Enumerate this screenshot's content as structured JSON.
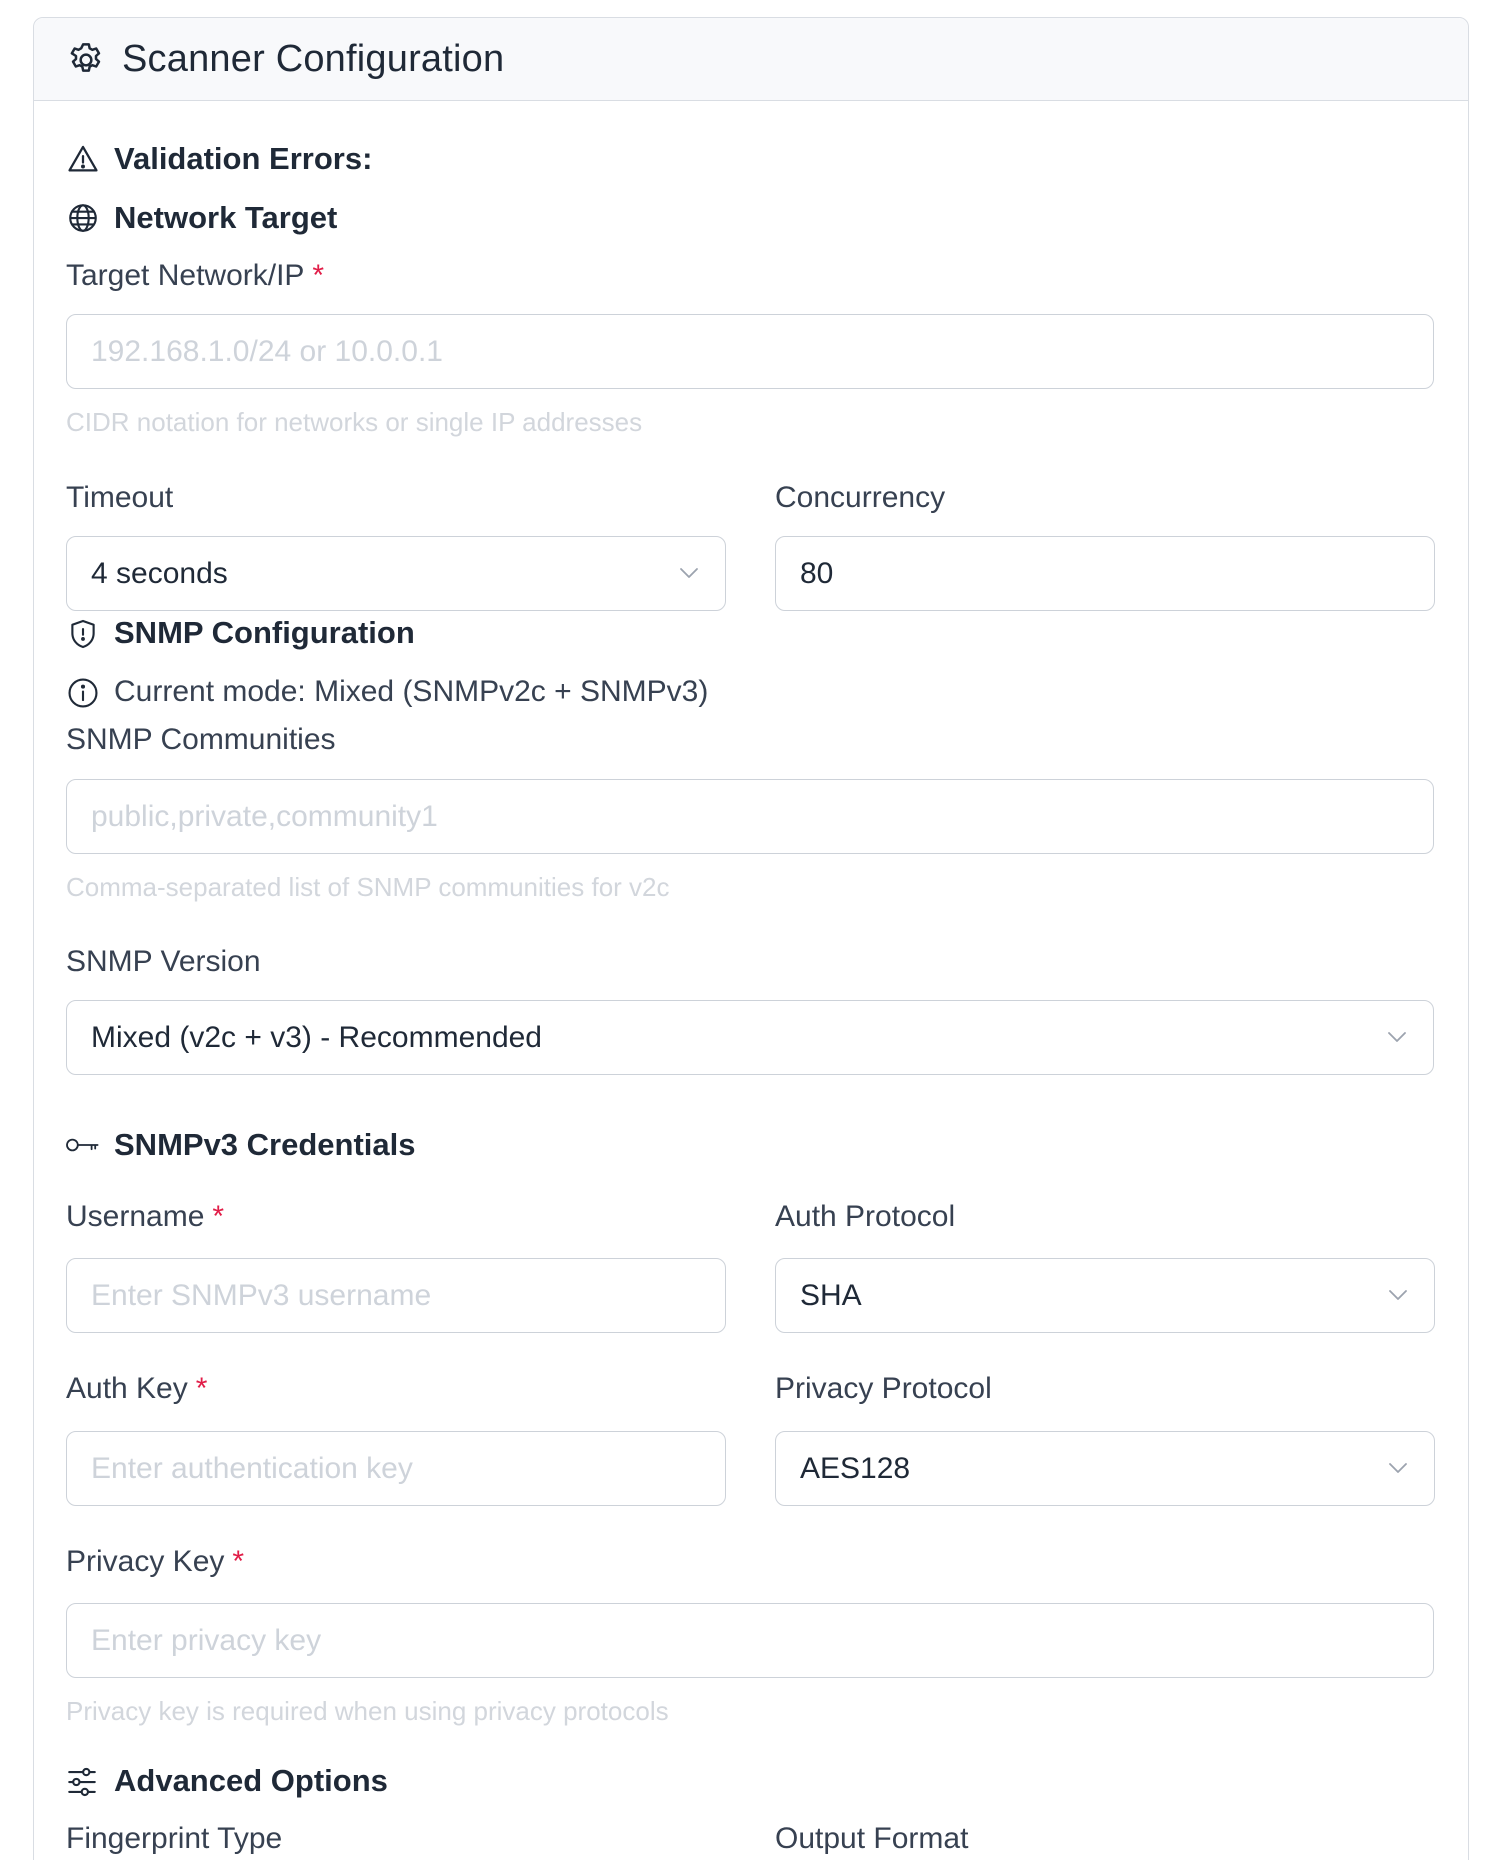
{
  "header": {
    "title": "Scanner Configuration",
    "icon": "gear-icon"
  },
  "validation": {
    "title": "Validation Errors:",
    "icon": "warning-triangle-icon"
  },
  "network": {
    "title": "Network Target",
    "icon": "globe-icon",
    "target_label": "Target Network/IP",
    "target_required": "*",
    "target_placeholder": "192.168.1.0/24 or 10.0.0.1",
    "target_help": "CIDR notation for networks or single IP addresses",
    "timeout_label": "Timeout",
    "timeout_value": "4 seconds",
    "concurrency_label": "Concurrency",
    "concurrency_value": "80"
  },
  "snmp": {
    "title": "SNMP Configuration",
    "icon": "shield-icon",
    "mode_text": "Current mode: Mixed (SNMPv2c + SNMPv3)",
    "mode_icon": "info-icon",
    "communities_label": "SNMP Communities",
    "communities_placeholder": "public,private,community1",
    "communities_help": "Comma-separated list of SNMP communities for v2c",
    "version_label": "SNMP Version",
    "version_value": "Mixed (v2c + v3) - Recommended"
  },
  "snmpv3": {
    "title": "SNMPv3 Credentials",
    "icon": "key-icon",
    "username_label": "Username",
    "username_required": "*",
    "username_placeholder": "Enter SNMPv3 username",
    "auth_protocol_label": "Auth Protocol",
    "auth_protocol_value": "SHA",
    "auth_key_label": "Auth Key",
    "auth_key_required": "*",
    "auth_key_placeholder": "Enter authentication key",
    "privacy_protocol_label": "Privacy Protocol",
    "privacy_protocol_value": "AES128",
    "privacy_key_label": "Privacy Key",
    "privacy_key_required": "*",
    "privacy_key_placeholder": "Enter privacy key",
    "privacy_key_help": "Privacy key is required when using privacy protocols"
  },
  "advanced": {
    "title": "Advanced Options",
    "icon": "sliders-icon",
    "fingerprint_label": "Fingerprint Type",
    "output_format_label": "Output Format"
  },
  "colors": {
    "required": "#e11d48",
    "border": "#cdd2d9",
    "header_bg": "#f8f9fb"
  }
}
